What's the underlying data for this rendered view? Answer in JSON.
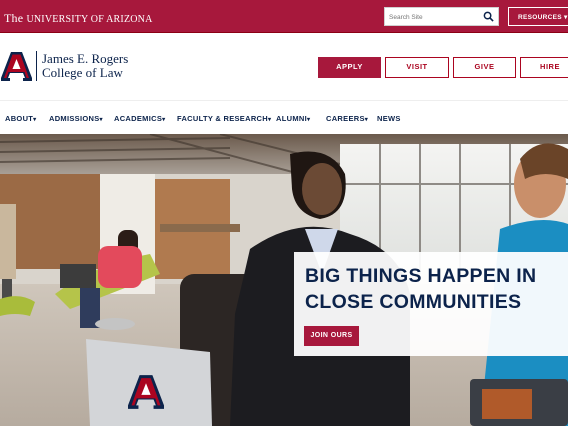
{
  "topbar": {
    "brand_the": "The ",
    "brand_name": "University of Arizona",
    "search_placeholder": "Search Site",
    "resources_label": "RESOURCES",
    "resources_caret": "▾"
  },
  "header": {
    "college_line1": "James E. Rogers",
    "college_line2": "College of Law"
  },
  "cta": {
    "apply": "APPLY",
    "visit": "VISIT",
    "give": "GIVE",
    "hire": "HIRE"
  },
  "nav": {
    "items": [
      {
        "label": "ABOUT",
        "caret": "▾"
      },
      {
        "label": "ADMISSIONS",
        "caret": "▾"
      },
      {
        "label": "ACADEMICS",
        "caret": "▾"
      },
      {
        "label": "FACULTY & RESEARCH",
        "caret": "▾"
      },
      {
        "label": "ALUMNI",
        "caret": "▾"
      },
      {
        "label": "CAREERS",
        "caret": "▾"
      },
      {
        "label": "NEWS",
        "caret": ""
      }
    ]
  },
  "hero": {
    "headline_line1": "BIG THINGS HAPPEN IN",
    "headline_line2": "CLOSE COMMUNITIES",
    "button_label": "JOIN OURS"
  },
  "colors": {
    "brand_red": "#a7183c",
    "navy": "#0c234b"
  }
}
